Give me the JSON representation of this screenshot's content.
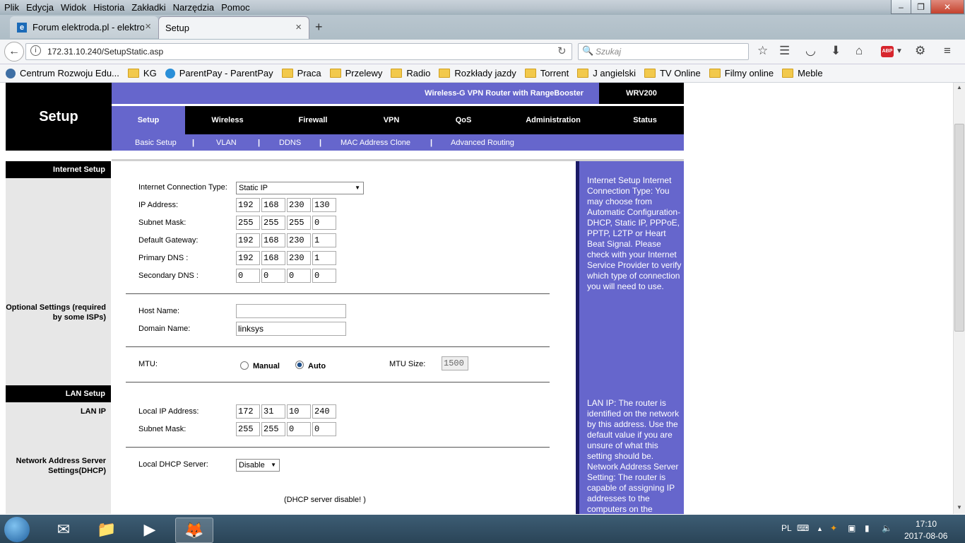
{
  "menu": [
    "Plik",
    "Edycja",
    "Widok",
    "Historia",
    "Zakładki",
    "Narzędzia",
    "Pomoc"
  ],
  "window_controls": {
    "minimize": "–",
    "maximize": "❐",
    "close": "✕"
  },
  "tabs": [
    {
      "label": "Forum elektroda.pl - elektron",
      "active": false
    },
    {
      "label": "Setup",
      "active": true
    }
  ],
  "new_tab": "+",
  "url": "172.31.10.240/SetupStatic.asp",
  "search_placeholder": "Szukaj",
  "bookmarks": [
    "Centrum Rozwoju Edu...",
    "KG",
    "ParentPay - ParentPay",
    "Praca",
    "Przelewy",
    "Radio",
    "Rozkłady jazdy",
    "Torrent",
    "J angielski",
    "TV Online",
    "Filmy online",
    "Meble"
  ],
  "router": {
    "page_title": "Setup",
    "product_name": "Wireless-G VPN Router with RangeBooster",
    "model": "WRV200",
    "main_tabs": [
      "Setup",
      "Wireless",
      "Firewall",
      "VPN",
      "QoS",
      "Administration",
      "Status"
    ],
    "sub_tabs": [
      "Basic Setup",
      "VLAN",
      "DDNS",
      "MAC Address Clone",
      "Advanced Routing"
    ],
    "sections": {
      "internet_setup": "Internet Setup",
      "optional_settings": "Optional Settings (required by some ISPs)",
      "lan_setup": "LAN Setup",
      "lan_ip": "LAN IP",
      "nas_settings": "Network Address Server Settings(DHCP)"
    },
    "internet": {
      "conn_type_label": "Internet Connection Type:",
      "conn_type_value": "Static IP",
      "ip_label": "IP Address:",
      "ip": [
        "192",
        "168",
        "230",
        "130"
      ],
      "mask_label": "Subnet Mask:",
      "mask": [
        "255",
        "255",
        "255",
        "0"
      ],
      "gw_label": "Default Gateway:",
      "gw": [
        "192",
        "168",
        "230",
        "1"
      ],
      "dns1_label": "Primary DNS :",
      "dns1": [
        "192",
        "168",
        "230",
        "1"
      ],
      "dns2_label": "Secondary DNS :",
      "dns2": [
        "0",
        "0",
        "0",
        "0"
      ]
    },
    "optional": {
      "host_label": "Host Name:",
      "host_value": "",
      "domain_label": "Domain Name:",
      "domain_value": "linksys",
      "mtu_label": "MTU:",
      "mtu_manual": "Manual",
      "mtu_auto": "Auto",
      "mtu_selected": "Auto",
      "mtu_size_label": "MTU Size:",
      "mtu_size_value": "1500"
    },
    "lan": {
      "local_ip_label": "Local IP Address:",
      "local_ip": [
        "172",
        "31",
        "10",
        "240"
      ],
      "mask_label": "Subnet Mask:",
      "mask": [
        "255",
        "255",
        "0",
        "0"
      ]
    },
    "dhcp": {
      "label": "Local DHCP Server:",
      "value": "Disable",
      "note": "(DHCP server disable! )"
    },
    "help": {
      "internet": "Internet Setup Internet Connection Type: You may choose from Automatic Configuration-DHCP, Static IP, PPPoE, PPTP, L2TP or Heart Beat Signal. Please check with your Internet Service Provider to verify which type of connection you will need to use.",
      "lan": "LAN IP: The router is identified on the network by this address. Use the default value if you are unsure of what this setting should be. Network Address Server Setting: The router is capable of assigning IP addresses to the computers on the"
    }
  },
  "tray": {
    "lang": "PL",
    "time": "17:10",
    "date": "2017-08-06"
  },
  "colors": {
    "router_purple": "#6666cc",
    "router_black": "#000000",
    "help_border": "#1a1a66"
  }
}
